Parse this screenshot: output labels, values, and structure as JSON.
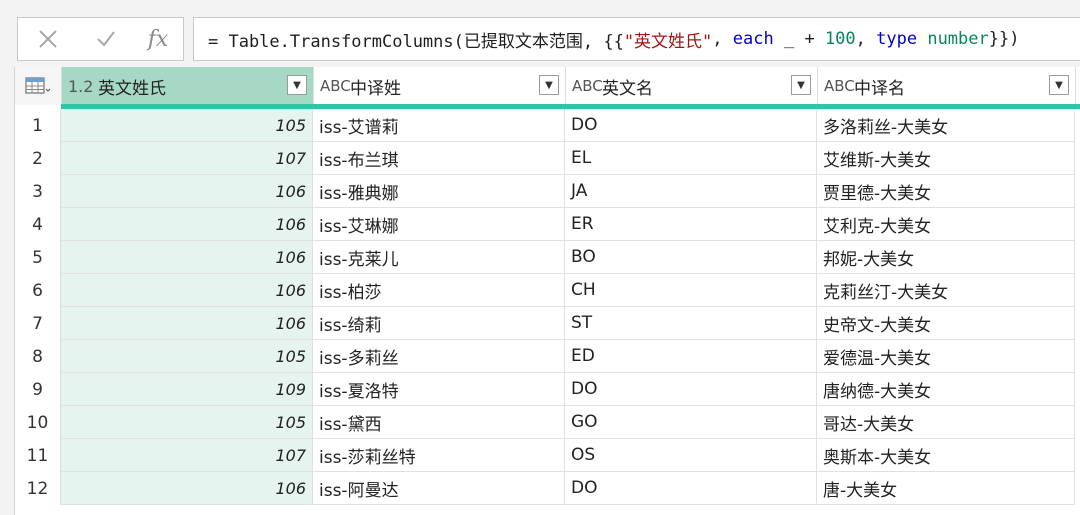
{
  "formula_bar": {
    "cancel_icon": "x-icon",
    "confirm_icon": "check-icon",
    "fx_label": "fx",
    "formula_parts": {
      "p1": "= Table.TransformColumns(已提取文本范围, {{",
      "p2": "\"英文姓氏\"",
      "p3": ", ",
      "p4": "each",
      "p5": " _ + ",
      "p6": "100",
      "p7": ", ",
      "p8": "type",
      "p9": " ",
      "p10": "number",
      "p11": "}})"
    }
  },
  "table": {
    "corner_icon": "table-icon",
    "columns": [
      {
        "type_label": "1.2",
        "name": "英文姓氏"
      },
      {
        "type_label": "ABC",
        "name": "中译姓"
      },
      {
        "type_label": "ABC",
        "name": "英文名"
      },
      {
        "type_label": "ABC",
        "name": "中译名"
      }
    ],
    "rows": [
      {
        "n": "1",
        "c1": "105",
        "c2": "iss-艾谱莉",
        "c3": "DO",
        "c4": "多洛莉丝-大美女"
      },
      {
        "n": "2",
        "c1": "107",
        "c2": "iss-布兰琪",
        "c3": "EL",
        "c4": "艾维斯-大美女"
      },
      {
        "n": "3",
        "c1": "106",
        "c2": "iss-雅典娜",
        "c3": "JA",
        "c4": "贾里德-大美女"
      },
      {
        "n": "4",
        "c1": "106",
        "c2": "iss-艾琳娜",
        "c3": "ER",
        "c4": "艾利克-大美女"
      },
      {
        "n": "5",
        "c1": "106",
        "c2": "iss-克莱儿",
        "c3": "BO",
        "c4": "邦妮-大美女"
      },
      {
        "n": "6",
        "c1": "106",
        "c2": "iss-柏莎",
        "c3": "CH",
        "c4": "克莉丝汀-大美女"
      },
      {
        "n": "7",
        "c1": "106",
        "c2": "iss-绮莉",
        "c3": "ST",
        "c4": "史帝文-大美女"
      },
      {
        "n": "8",
        "c1": "105",
        "c2": "iss-多莉丝",
        "c3": "ED",
        "c4": "爱德温-大美女"
      },
      {
        "n": "9",
        "c1": "109",
        "c2": "iss-夏洛特",
        "c3": "DO",
        "c4": "唐纳德-大美女"
      },
      {
        "n": "10",
        "c1": "105",
        "c2": "iss-黛西",
        "c3": "GO",
        "c4": "哥达-大美女"
      },
      {
        "n": "11",
        "c1": "107",
        "c2": "iss-莎莉丝特",
        "c3": "OS",
        "c4": "奥斯本-大美女"
      },
      {
        "n": "12",
        "c1": "106",
        "c2": "iss-阿曼达",
        "c3": "DO",
        "c4": "唐-大美女"
      }
    ]
  }
}
